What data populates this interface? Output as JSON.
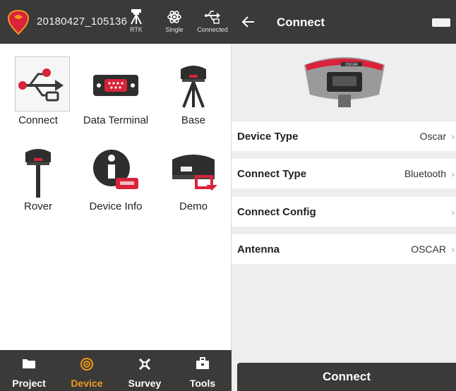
{
  "left": {
    "header": {
      "project_name": "20180427_105136",
      "status": [
        {
          "icon": "rtk-antenna-icon",
          "label": "RTK"
        },
        {
          "icon": "satellite-atom-icon",
          "label": "Single"
        },
        {
          "icon": "usb-connected-icon",
          "label": "Connected"
        }
      ]
    },
    "grid": [
      {
        "icon": "usb-connect-icon",
        "label": "Connect"
      },
      {
        "icon": "data-terminal-icon",
        "label": "Data Terminal"
      },
      {
        "icon": "base-station-icon",
        "label": "Base"
      },
      {
        "icon": "rover-icon",
        "label": "Rover"
      },
      {
        "icon": "device-info-icon",
        "label": "Device Info"
      },
      {
        "icon": "demo-icon",
        "label": "Demo"
      }
    ],
    "tabs": [
      {
        "icon": "folder-icon",
        "label": "Project"
      },
      {
        "icon": "device-tab-icon",
        "label": "Device"
      },
      {
        "icon": "survey-icon",
        "label": "Survey"
      },
      {
        "icon": "toolbox-icon",
        "label": "Tools"
      }
    ],
    "active_tab": "Device"
  },
  "right": {
    "header": {
      "title": "Connect"
    },
    "device_brand": "OSCAR",
    "settings": [
      {
        "label": "Device Type",
        "value": "Oscar"
      },
      {
        "label": "Connect Type",
        "value": "Bluetooth"
      },
      {
        "label": "Connect Config",
        "value": ""
      },
      {
        "label": "Antenna",
        "value": "OSCAR"
      }
    ],
    "connect_button": "Connect"
  },
  "colors": {
    "header_bg": "#3b3a38",
    "accent_orange": "#f29b1d",
    "device_red": "#d8233a",
    "panel_bg": "#eeeeee"
  }
}
